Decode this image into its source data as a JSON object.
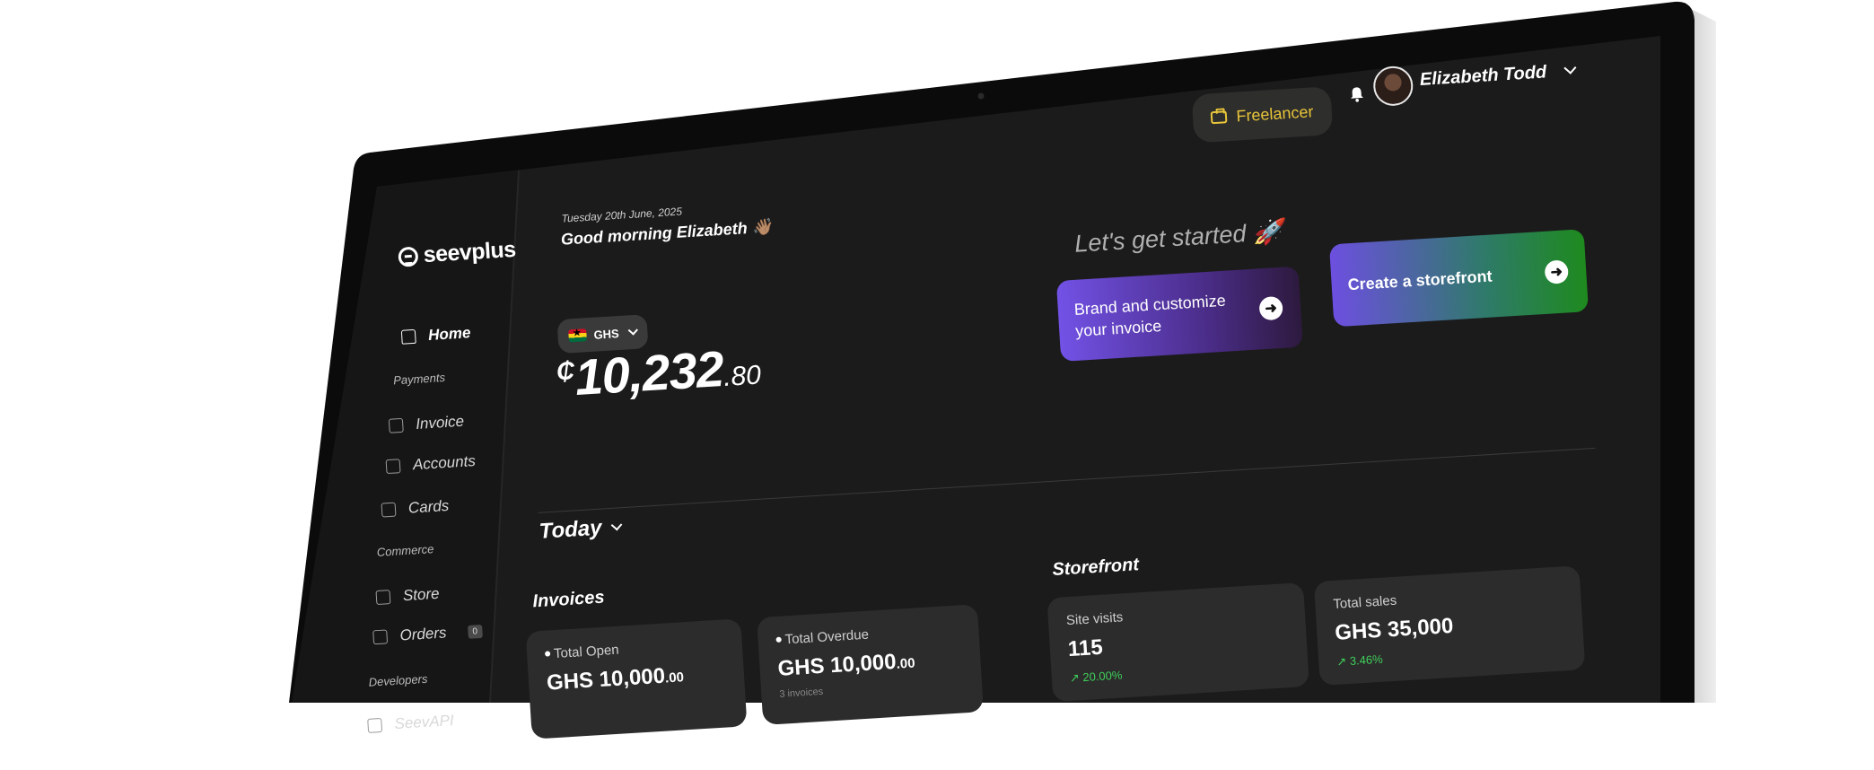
{
  "brand": {
    "name": "seevplus"
  },
  "sidebar": {
    "items": [
      {
        "label": "Home",
        "icon": "home-icon",
        "active": true
      },
      {
        "section": "Payments"
      },
      {
        "label": "Invoice",
        "icon": "invoice-icon"
      },
      {
        "label": "Accounts",
        "icon": "wallet-icon"
      },
      {
        "label": "Cards",
        "icon": "card-icon"
      },
      {
        "section": "Commerce"
      },
      {
        "label": "Store",
        "icon": "store-icon"
      },
      {
        "label": "Orders",
        "icon": "cart-icon",
        "badge": "0"
      },
      {
        "section": "Developers"
      },
      {
        "label": "SeevAPI",
        "icon": "api-icon"
      }
    ]
  },
  "header": {
    "date": "Tuesday 20th June, 2025",
    "greeting": "Good morning Elizabeth 👋🏽",
    "account_type": "Freelancer",
    "user_name": "Elizabeth Todd"
  },
  "balance": {
    "currency": "GHS",
    "symbol": "₵",
    "whole": "10,232",
    "decimal": ".80"
  },
  "get_started": {
    "title": "Let's get started 🚀",
    "cta_brand": "Brand and customize your invoice",
    "cta_storefront": "Create a storefront"
  },
  "period": {
    "label": "Today"
  },
  "invoices": {
    "title": "Invoices",
    "total_open_label": "Total Open",
    "total_open_value": "GHS 10,000",
    "total_open_decimal": ".00",
    "total_overdue_label": "Total Overdue",
    "total_overdue_value": "GHS 10,000",
    "total_overdue_decimal": ".00",
    "total_overdue_sub": "3 invoices"
  },
  "storefront": {
    "title": "Storefront",
    "site_visits_label": "Site visits",
    "site_visits_value": "115",
    "site_visits_delta": "↗ 20.00%",
    "total_sales_label": "Total sales",
    "total_sales_value": "GHS 35,000",
    "total_sales_delta": "↗ 3.46%"
  },
  "colors": {
    "screen_bg": "#1b1b1b",
    "sidebar_bg": "#161616",
    "accent_yellow": "#e8c53a",
    "positive_green": "#3fcf5a",
    "cta_purple": "#7252e6",
    "cta_green": "#1e8a1e"
  }
}
